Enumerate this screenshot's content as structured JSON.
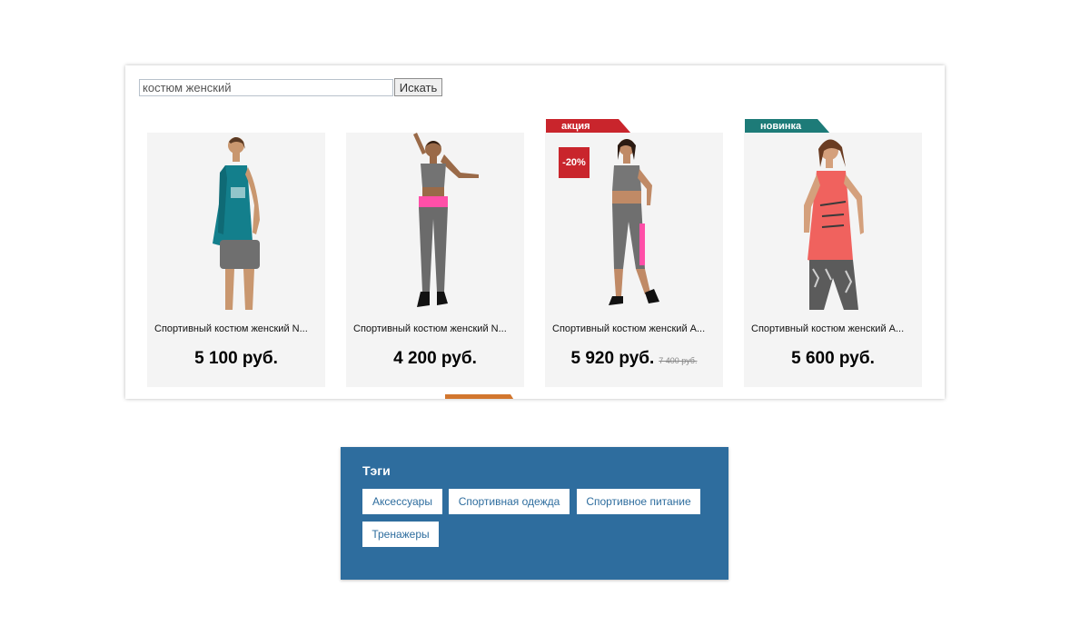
{
  "search": {
    "value": "костюм женский",
    "button_label": "Искать"
  },
  "products": [
    {
      "title": "Спортивный костюм женский N...",
      "price": "5 100 руб.",
      "image": "woman-teal-tank-shorts"
    },
    {
      "title": "Спортивный костюм женский N...",
      "price": "4 200 руб.",
      "image": "woman-gray-leggings-pink-band"
    },
    {
      "title": "Спортивный костюм женский А...",
      "price": "5 920 руб.",
      "old_price": "7 400 руб.",
      "ribbon": "акция",
      "discount": "-20%",
      "image": "woman-gray-capri-set"
    },
    {
      "title": "Спортивный костюм женский А...",
      "price": "5 600 руб.",
      "ribbon": "новинка",
      "image": "woman-coral-tank-patterned-leggings"
    }
  ],
  "partial_ribbon": {
    "color": "#d2762e"
  },
  "tags": {
    "title": "Тэги",
    "items": [
      "Аксессуары",
      "Спортивная одежда",
      "Спортивное питание",
      "Тренажеры"
    ]
  },
  "colors": {
    "sale_ribbon": "#c9252c",
    "new_ribbon": "#1d7b78",
    "tags_background": "#2e6d9e",
    "card_background": "#f4f4f4"
  }
}
